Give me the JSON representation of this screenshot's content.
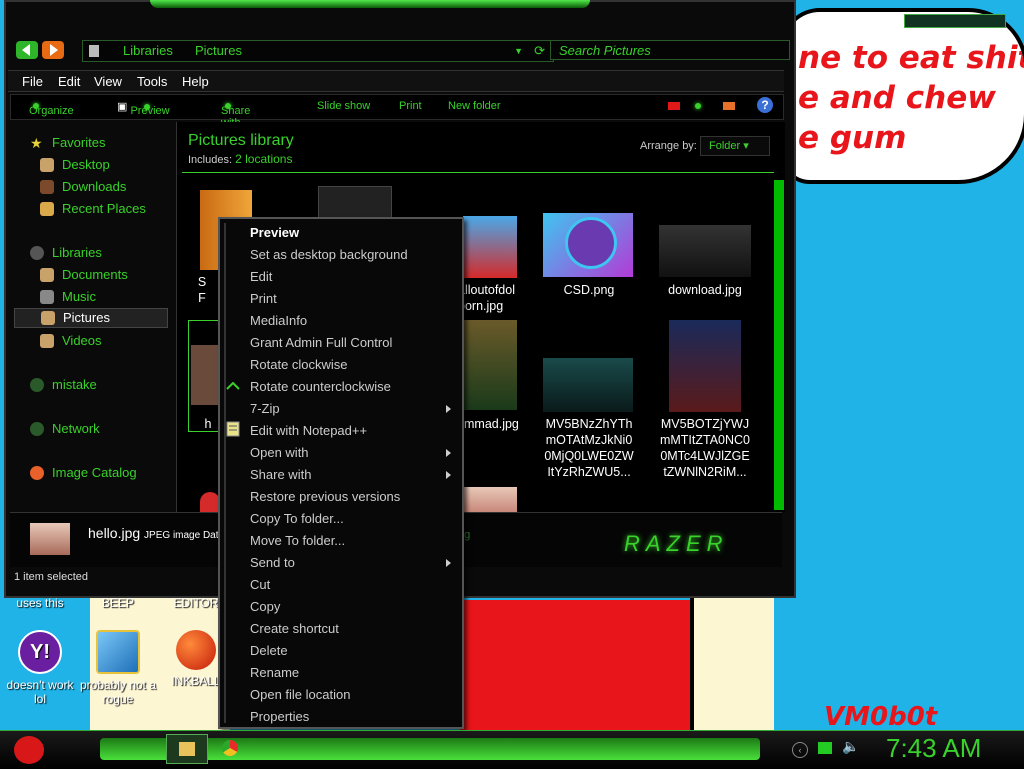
{
  "bubble": {
    "line1": "ne to eat shit",
    "line2": "e and chew",
    "line3": "e gum"
  },
  "desktop": {
    "partial_labels": [
      "uses this",
      "BEEP",
      "EDITOR"
    ],
    "icons": [
      {
        "label": "doesn't work lol",
        "icon": "yahoo-messenger-icon"
      },
      {
        "label": "probably not a rogue",
        "icon": "gears-app-icon"
      },
      {
        "label": "INKBALL",
        "icon": "inkball-icon"
      }
    ],
    "signature": "VM0b0t"
  },
  "explorer": {
    "breadcrumb": [
      "Libraries",
      "Pictures"
    ],
    "search_placeholder": "Search Pictures",
    "menu": [
      "File",
      "Edit",
      "View",
      "Tools",
      "Help"
    ],
    "toolbar": [
      "Organize",
      "Preview",
      "Share with",
      "Slide show",
      "Print",
      "New folder"
    ],
    "nav": {
      "favorites": "Favorites",
      "favorites_items": [
        "Desktop",
        "Downloads",
        "Recent Places"
      ],
      "libraries": "Libraries",
      "libraries_items": [
        "Documents",
        "Music",
        "Pictures",
        "Videos"
      ],
      "homegroup": "mistake",
      "network": "Network",
      "image_catalog": "Image Catalog"
    },
    "library_title": "Pictures library",
    "includes_label": "Includes:",
    "includes_link": "2 locations",
    "arrange_label": "Arrange by:",
    "arrange_value": "Folder",
    "files": [
      {
        "name": "alloutofdol\nborn.jpg"
      },
      {
        "name": "CSD.png"
      },
      {
        "name": "download.jpg"
      },
      {
        "name": "mmad.jpg"
      },
      {
        "name": "MV5BNzZhYTh\nmOTAtMzJkNi0\n0MjQ0LWE0ZW\nItYzRhZWU5..."
      },
      {
        "name": "MV5BOTZjYWJ\nmMTItZTA0NC0\n0MTc4LWJlZGE\ntZWNlN2RiM..."
      }
    ],
    "partial_file_labels": [
      "S",
      "F",
      "h",
      "ag"
    ],
    "details_name": "hello.jpg",
    "details_type": "JPEG image Dat",
    "status": "1 item selected",
    "brand": "RAZER"
  },
  "context_menu": [
    {
      "label": "Preview",
      "bold": true
    },
    {
      "label": "Set as desktop background"
    },
    {
      "label": "Edit"
    },
    {
      "label": "Print"
    },
    {
      "label": "MediaInfo"
    },
    {
      "label": "Grant Admin Full Control"
    },
    {
      "label": "Rotate clockwise"
    },
    {
      "label": "Rotate counterclockwise"
    },
    {
      "label": "7-Zip",
      "submenu": true
    },
    {
      "label": "Edit with Notepad++"
    },
    {
      "label": "Open with",
      "submenu": true
    },
    {
      "label": "Share with",
      "submenu": true
    },
    {
      "label": "Restore previous versions"
    },
    {
      "label": "Copy To folder..."
    },
    {
      "label": "Move To folder..."
    },
    {
      "label": "Send to",
      "submenu": true
    },
    {
      "label": "Cut"
    },
    {
      "label": "Copy"
    },
    {
      "label": "Create shortcut"
    },
    {
      "label": "Delete"
    },
    {
      "label": "Rename"
    },
    {
      "label": "Open file location"
    },
    {
      "label": "Properties"
    }
  ],
  "taskbar": {
    "clock": "7:43 AM"
  },
  "colors": {
    "accent": "#39d12b",
    "desktop": "#1fb3e8",
    "red": "#e8151b"
  }
}
